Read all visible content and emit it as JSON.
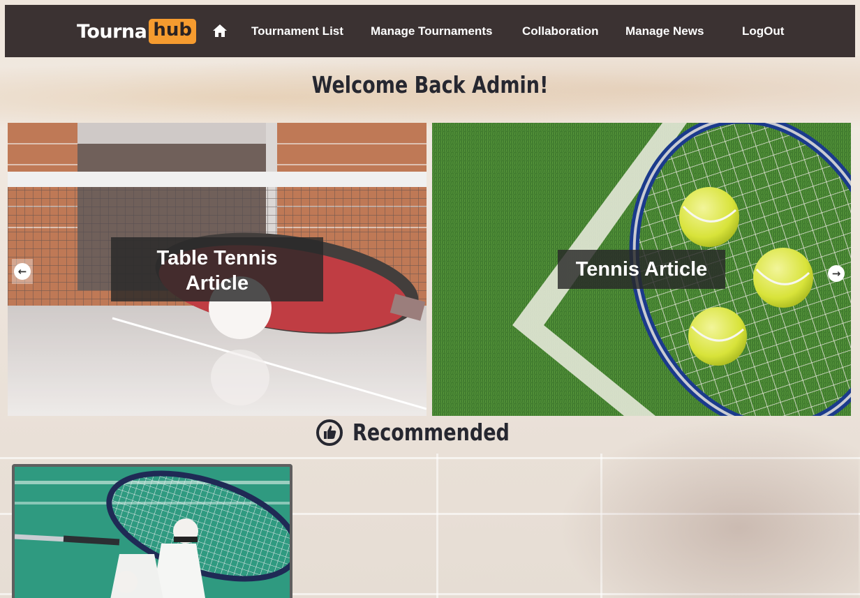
{
  "brand": {
    "name_part1": "Tourna",
    "name_part2": "hub",
    "accent_color": "#f59b2f",
    "nav_bg": "#3b3232"
  },
  "nav": {
    "home_icon": "home-icon",
    "links": [
      {
        "label": "Tournament List"
      },
      {
        "label": "Manage Tournaments"
      },
      {
        "label": "Collaboration"
      },
      {
        "label": "Manage News"
      },
      {
        "label": "LogOut"
      }
    ]
  },
  "welcome": "Welcome Back Admin!",
  "carousel": {
    "slides": [
      {
        "caption_line1": "Table Tennis",
        "caption_line2": "Article",
        "image": "table-tennis-image"
      },
      {
        "caption": "Tennis Article",
        "image": "tennis-image"
      }
    ],
    "prev_icon": "arrow-left-icon",
    "next_icon": "arrow-right-icon"
  },
  "recommended": {
    "title": "Recommended",
    "icon": "thumbs-up-icon",
    "cards": [
      {
        "image": "badminton-image"
      }
    ]
  }
}
